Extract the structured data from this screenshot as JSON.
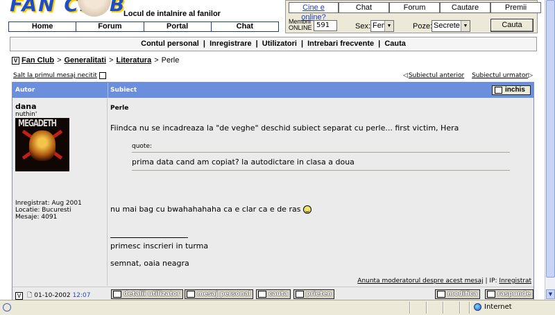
{
  "header": {
    "logo_text": "FAN CLUB",
    "tagline": "Locul de intalnire al fanilor",
    "nav": [
      "Home",
      "Forum",
      "Portal",
      "Chat"
    ]
  },
  "panel": {
    "tabs": [
      "Cine e online?",
      "Chat",
      "Forum",
      "Cautare",
      "Premii"
    ],
    "members_label_line1": "Membrii",
    "members_label_line2": "ONLINE",
    "members_count": "591",
    "sex_label": "Sex:",
    "sex_value": "Fem",
    "pose_label": "Poze:",
    "pose_value": "Secrete",
    "search_button": "Cauta"
  },
  "linkbar": {
    "links": [
      "Contul personal",
      "Inregistrare",
      "Utilizatori",
      "Intrebari frecvente",
      "Cauta"
    ],
    "separator": "|"
  },
  "breadcrumb": {
    "items": [
      "Fan Club",
      "Generalitati",
      "Literatura"
    ],
    "current": "Perle",
    "separator": ">"
  },
  "topic_nav": {
    "jump_unread": "Salt la primul mesaj necitit",
    "prev": "Subiectul anterior",
    "next": "Subiectul urmator"
  },
  "post_table": {
    "col_author": "Autor",
    "col_subject": "Subiect",
    "close_button": "inchis"
  },
  "post": {
    "author_name": "dana",
    "author_rank": "nuthin'",
    "avatar_text": "MEGADETH",
    "registered": "Inregistrat: Aug 2001",
    "location": "Locatie: Bucuresti",
    "messages": "Mesaje: 4091",
    "subject": "Perle",
    "paragraph1": "Fiindca nu se incadreaza la \"de veghe\" deschid subiect separat cu perle... first victim, Hera",
    "quote_label": "quote:",
    "quote_text": "prima data cand am copiat? la autodictare in clasa a doua",
    "paragraph2": "nu mai bag cu bwahahahaha ca e clar ca e de ras",
    "signature1": "primesc inscrieri in turma",
    "signature2": "semnat, oaia neagra",
    "report_link": "Anunta moderatorul despre acest mesaj",
    "ip_label": "IP:",
    "ip_value": "Inregistrat",
    "date": "01-10-2002",
    "time": "12:07",
    "buttons_left": [
      "detalii utilizator",
      "mesaj personal",
      "cauta",
      "prieten"
    ],
    "buttons_right": [
      "modifica",
      "raspunde"
    ]
  },
  "statusbar": {
    "zone": "Internet"
  }
}
